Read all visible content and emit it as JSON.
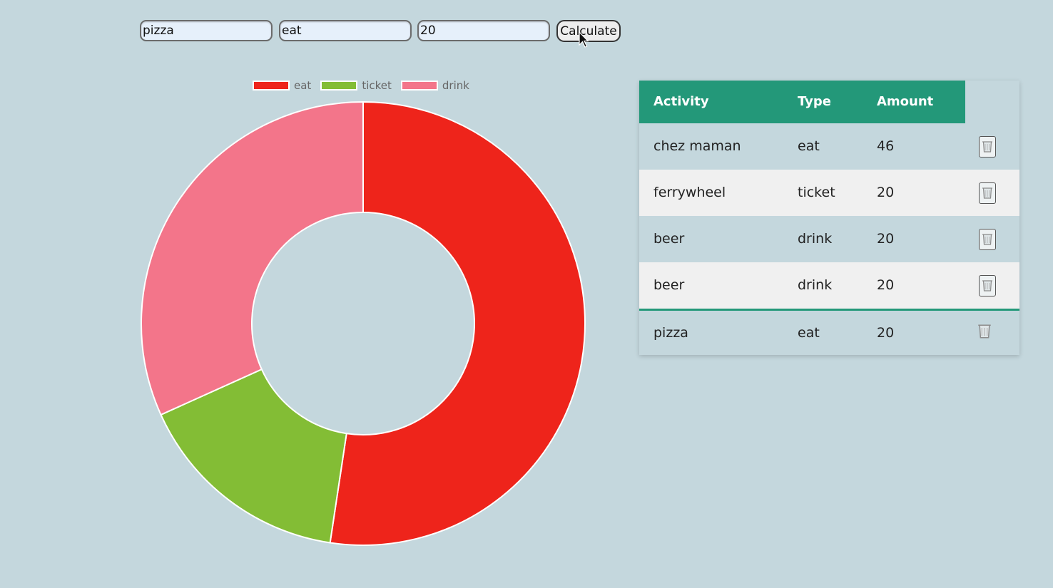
{
  "form": {
    "activity_value": "pizza",
    "type_value": "eat",
    "amount_value": "20",
    "calculate_label": "Calculate"
  },
  "chart_data": {
    "type": "doughnut",
    "categories": [
      "eat",
      "ticket",
      "drink"
    ],
    "values": [
      66,
      20,
      40
    ],
    "colors": [
      "#ee241b",
      "#83bd35",
      "#f3758a"
    ],
    "legend": "top"
  },
  "table": {
    "headers": [
      "Activity",
      "Type",
      "Amount"
    ],
    "rows": [
      {
        "activity": "chez maman",
        "type": "eat",
        "amount": "46"
      },
      {
        "activity": "ferrywheel",
        "type": "ticket",
        "amount": "20"
      },
      {
        "activity": "beer",
        "type": "drink",
        "amount": "20"
      },
      {
        "activity": "beer",
        "type": "drink",
        "amount": "20"
      },
      {
        "activity": "pizza",
        "type": "eat",
        "amount": "20"
      }
    ],
    "delete_icon": "trash-icon"
  },
  "colors": {
    "background": "#c4d7dd",
    "header": "#239879",
    "stripe": "#f0f0f0"
  }
}
